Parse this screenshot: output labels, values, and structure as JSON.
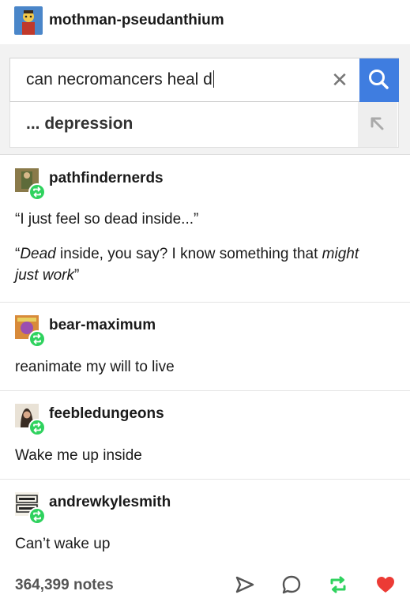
{
  "op": {
    "username": "mothman-pseudanthium",
    "avatar_icon": "cartoon-avatar-icon"
  },
  "search": {
    "query": "can necromancers heal d",
    "clear_glyph": "✕",
    "suggestion": "... depression",
    "accent": "#3f7de0"
  },
  "reblogs": [
    {
      "username": "pathfindernerds",
      "avatar_icon": "character-art-avatar-icon",
      "lines": [
        "“I just feel so dead inside...”"
      ],
      "quote": {
        "pre": "“",
        "i1": "Dead",
        "mid": " inside, you say? I know something that ",
        "i2": "might",
        "line2_i": "just work",
        "post": "”"
      }
    },
    {
      "username": "bear-maximum",
      "avatar_icon": "poster-avatar-icon",
      "text": "reanimate my will to live"
    },
    {
      "username": "feebledungeons",
      "avatar_icon": "portrait-avatar-icon",
      "text": "Wake me up inside"
    },
    {
      "username": "andrewkylesmith",
      "avatar_icon": "logo-avatar-icon",
      "text": "Can’t wake up"
    }
  ],
  "footer": {
    "notes": "364,399 notes",
    "reblog_color": "#2fd25e",
    "like_color": "#ec3b35"
  }
}
